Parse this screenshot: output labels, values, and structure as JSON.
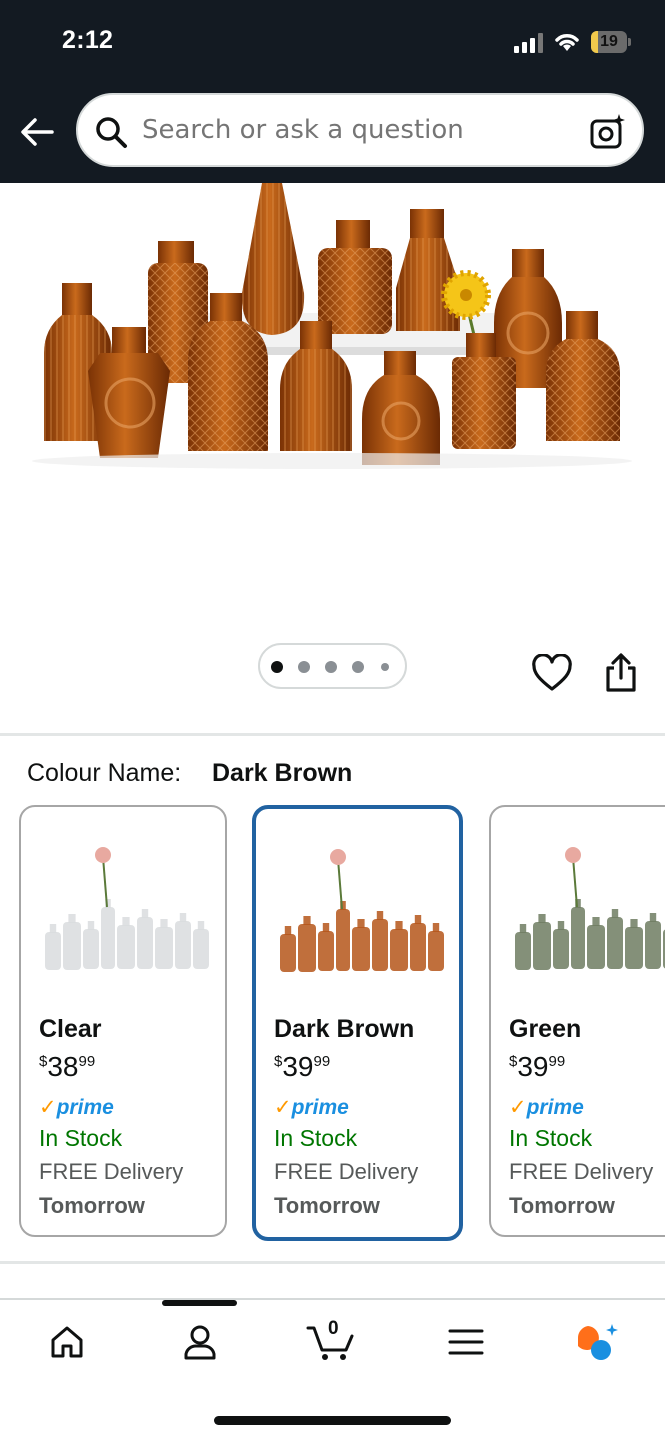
{
  "status_bar": {
    "time": "2:12",
    "battery": "19",
    "battery_fraction": 0.19
  },
  "header": {
    "search_placeholder": "Search or ask a question",
    "back_icon": "arrow-left-icon",
    "search_icon": "magnifier-icon",
    "camera_icon": "camera-sparkle-icon"
  },
  "gallery": {
    "image": "amber-glass-bud-vases",
    "page_count": 5,
    "active_page": 1
  },
  "colour": {
    "label": "Colour Name:",
    "selected": "Dark Brown"
  },
  "variants": [
    {
      "name": "Clear",
      "price_symbol": "$",
      "price_whole": "38",
      "price_fraction": "99",
      "prime": "prime",
      "stock": "In Stock",
      "delivery": "FREE Delivery",
      "when": "Tomorrow",
      "tint": "#d9dcde"
    },
    {
      "name": "Dark Brown",
      "price_symbol": "$",
      "price_whole": "39",
      "price_fraction": "99",
      "prime": "prime",
      "stock": "In Stock",
      "delivery": "FREE Delivery",
      "when": "Tomorrow",
      "tint": "#b5561a"
    },
    {
      "name": "Green",
      "price_symbol": "$",
      "price_whole": "39",
      "price_fraction": "99",
      "prime": "prime",
      "stock": "In Stock",
      "delivery": "FREE Delivery",
      "when": "Tomorrow",
      "tint": "#6f7d61"
    }
  ],
  "bottom_nav": {
    "items": [
      "home-icon",
      "account-icon",
      "cart-icon",
      "menu-icon",
      "rufus-icon"
    ],
    "cart_count": "0",
    "active_index": 1
  },
  "colors": {
    "header_bg": "#131a22",
    "selected_border": "#2162a1",
    "in_stock": "#007600",
    "prime_blue": "#1a8fe0",
    "prime_check": "#ff9900"
  }
}
